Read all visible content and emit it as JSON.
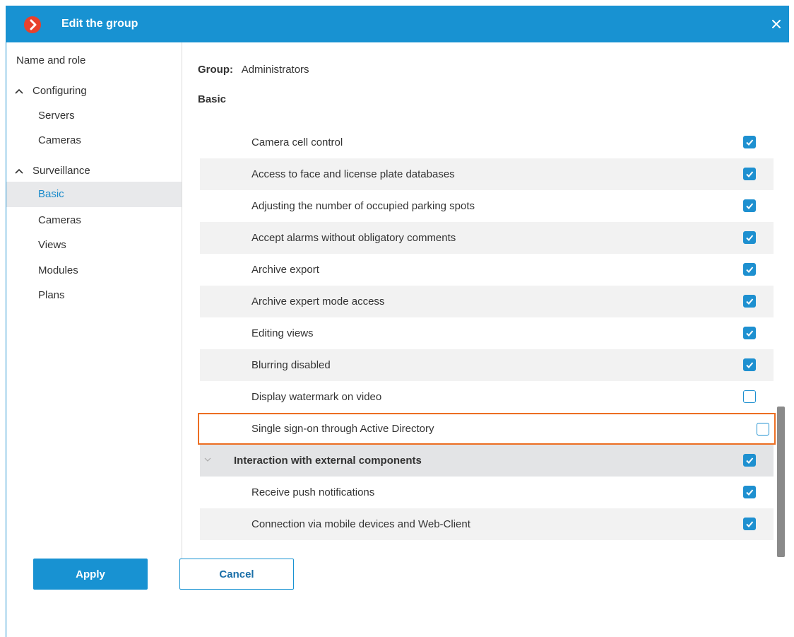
{
  "window": {
    "title": "Edit the group",
    "accent_color": "#1892d2",
    "logo_color": "#e8412c"
  },
  "nav": {
    "items": [
      {
        "label": "Name and role",
        "level": 0,
        "expandable": false,
        "selected": false
      },
      {
        "label": "Configuring",
        "level": 0,
        "expandable": true,
        "selected": false
      },
      {
        "label": "Servers",
        "level": 1,
        "expandable": false,
        "selected": false
      },
      {
        "label": "Cameras",
        "level": 1,
        "expandable": false,
        "selected": false
      },
      {
        "label": "Surveillance",
        "level": 0,
        "expandable": true,
        "selected": false
      },
      {
        "label": "Basic",
        "level": 1,
        "expandable": false,
        "selected": true
      },
      {
        "label": "Cameras",
        "level": 1,
        "expandable": false,
        "selected": false
      },
      {
        "label": "Views",
        "level": 1,
        "expandable": false,
        "selected": false
      },
      {
        "label": "Modules",
        "level": 1,
        "expandable": false,
        "selected": false
      },
      {
        "label": "Plans",
        "level": 1,
        "expandable": false,
        "selected": false
      }
    ]
  },
  "content": {
    "group_label": "Group:",
    "group_name": "Administrators",
    "section_title": "Basic",
    "permissions": [
      {
        "label": "Camera cell control",
        "checked": true,
        "kind": "item"
      },
      {
        "label": "Access to face and license plate databases",
        "checked": true,
        "kind": "item"
      },
      {
        "label": "Adjusting the number of occupied parking spots",
        "checked": true,
        "kind": "item"
      },
      {
        "label": "Accept alarms without obligatory comments",
        "checked": true,
        "kind": "item"
      },
      {
        "label": "Archive export",
        "checked": true,
        "kind": "item"
      },
      {
        "label": "Archive expert mode access",
        "checked": true,
        "kind": "item"
      },
      {
        "label": "Editing views",
        "checked": true,
        "kind": "item"
      },
      {
        "label": "Blurring disabled",
        "checked": true,
        "kind": "item"
      },
      {
        "label": "Display watermark on video",
        "checked": false,
        "kind": "item"
      },
      {
        "label": "Single sign-on through Active Directory",
        "checked": false,
        "kind": "item",
        "highlighted": true
      },
      {
        "label": "Interaction with external components",
        "checked": true,
        "kind": "group"
      },
      {
        "label": "Receive push notifications",
        "checked": true,
        "kind": "item"
      },
      {
        "label": "Connection via mobile devices and Web-Client",
        "checked": true,
        "kind": "item"
      }
    ]
  },
  "footer": {
    "apply_label": "Apply",
    "cancel_label": "Cancel"
  },
  "colors": {
    "highlight_border": "#ec6e22",
    "selected_text": "#1a8bcb",
    "checkbox": "#1e90d0"
  }
}
